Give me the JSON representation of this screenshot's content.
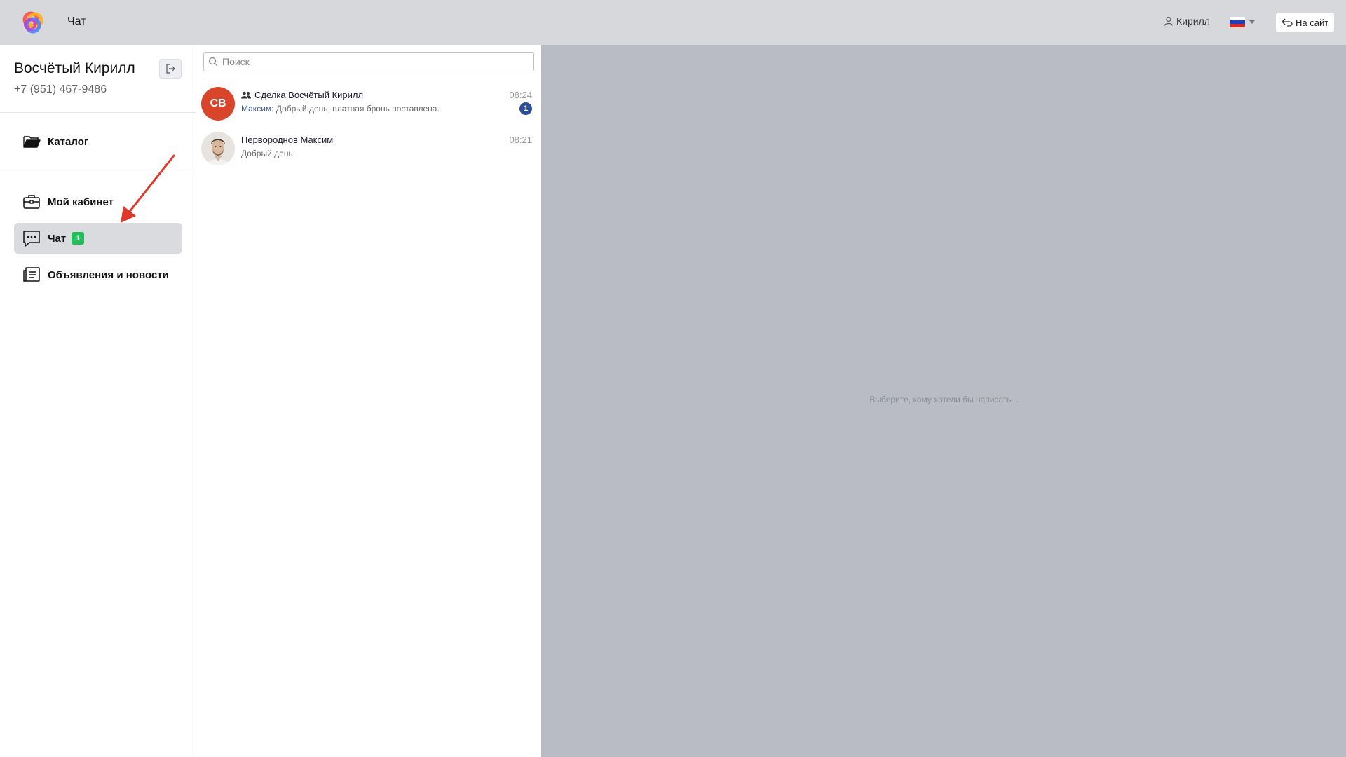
{
  "header": {
    "title": "Чат",
    "user_name": "Кирилл",
    "language_flag": "ru-flag-icon",
    "to_site_label": "На сайт"
  },
  "profile": {
    "name": "Восчётый Кирилл",
    "phone": "+7 (951) 467-9486"
  },
  "nav": {
    "catalog": "Каталог",
    "cabinet": "Мой кабинет",
    "chat": "Чат",
    "chat_badge": "1",
    "news": "Объявления и новости"
  },
  "search": {
    "placeholder": "Поиск"
  },
  "chats": [
    {
      "name": "Сделка Восчётый Кирилл",
      "initials": "СВ",
      "sender": "Максим:",
      "message": "Добрый день, платная бронь поставлена.",
      "time": "08:24",
      "unread": "1",
      "is_group": true
    },
    {
      "name": "Первороднов Максим",
      "message": "Добрый день",
      "time": "08:21"
    }
  ],
  "conversation": {
    "placeholder": "Выберите, кому хотели бы написать..."
  },
  "colors": {
    "accent_badge": "#1fbf5a",
    "unread_badge": "#2c4d9a",
    "avatar_initials_bg": "#d9452b",
    "arrow": "#e0392b"
  }
}
